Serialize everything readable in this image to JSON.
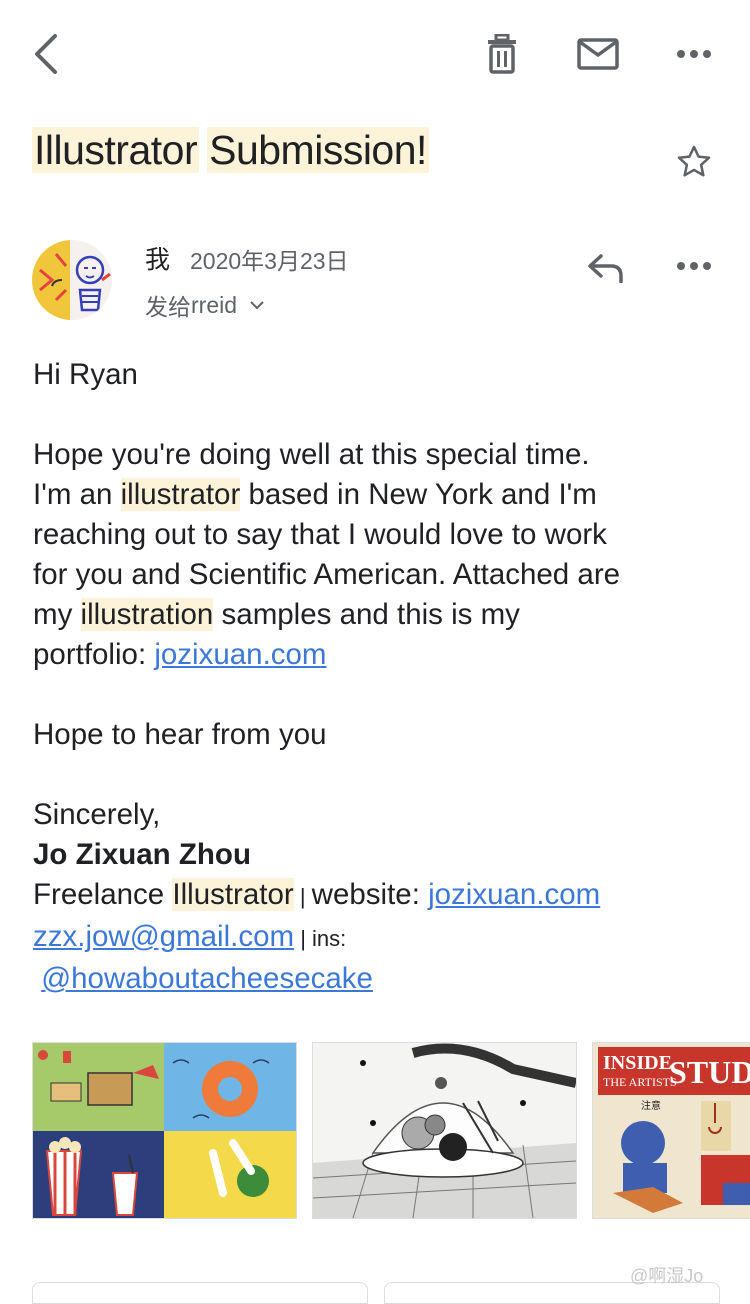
{
  "toolbar": {
    "back_icon": "chevron-left-icon",
    "delete_icon": "trash-icon",
    "mail_icon": "envelope-icon",
    "more_icon": "more-horizontal-icon"
  },
  "subject": {
    "word1": "Illustrator",
    "word2": "Submission",
    "punct": "!",
    "star_icon": "star-outline-icon"
  },
  "message": {
    "sender": "我",
    "date": "2020年3月23日",
    "to_prefix": "发给",
    "to_name": "rreid",
    "reply_icon": "reply-icon",
    "more_icon": "more-horizontal-icon"
  },
  "body": {
    "greeting": "Hi Ryan",
    "p1_a": "Hope you're doing well at this special time.",
    "p1_b": "I'm an ",
    "p1_c": "illustrator",
    "p1_d": " based in New York and I'm",
    "p1_e": "reaching out to say that I would love to work",
    "p1_f": "for you and Scientific American. Attached are",
    "p1_g": "my ",
    "p1_h": "illustration",
    "p1_i": " samples and this is my",
    "p1_j": "portfolio: ",
    "p1_link": "jozixuan.com",
    "p2": "Hope to hear from you",
    "closing": "Sincerely,",
    "sig_name": "Jo Zixuan Zhou",
    "sig_role_a": "Freelance ",
    "sig_role_b": "Illustrator",
    "sig_sep": " | ",
    "sig_website_label": "website: ",
    "sig_website": "jozixuan.com",
    "sig_email": "zzx.jow@gmail.com",
    "sig_ins_label": " | ins:",
    "sig_ins": "@howaboutacheesecake"
  },
  "attachments": {
    "thumb3_title_a": "INSIDE",
    "thumb3_title_b": "THE ARTISTS",
    "thumb3_title_c": "STUDIO",
    "thumb3_cn": "注意"
  },
  "watermark": "@啊湿Jo",
  "colors": {
    "highlight": "#fdf3d8",
    "link": "#3c78d8",
    "icon": "#5f6368"
  }
}
